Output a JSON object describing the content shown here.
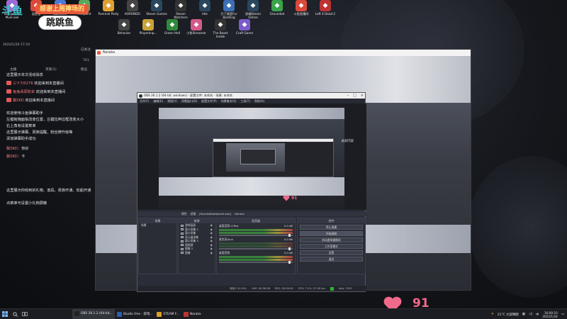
{
  "stream": {
    "logo_text": "斗鱼",
    "logo_tag": "感谢上周捧场的",
    "logo_bubble": "跳跳鱼",
    "heart_count": "91",
    "heart_count_obs": "91",
    "colors": {
      "heart": "#f06a8c",
      "accent": "#e8593c",
      "fish": "#3fc1c9"
    }
  },
  "desktop_icons": [
    {
      "icon": "bongo-cat-icon",
      "label": "Bongo Cat Mver.exe",
      "color": "#9b6bd6"
    },
    {
      "icon": "app-icon",
      "label": "逗鱼宝",
      "color": "#d84a3a"
    },
    {
      "icon": "launcher-icon",
      "label": "Launcher",
      "color": "#4a7bd8"
    },
    {
      "icon": "freeponit-icon",
      "label": "Freeponit",
      "color": "#5aa85a"
    },
    {
      "icon": "pummel-party-icon",
      "label": "Pummel Party",
      "color": "#e0a030"
    },
    {
      "icon": "korondo-icon",
      "label": "KORONDO",
      "color": "#444"
    },
    {
      "icon": "steam-icon",
      "label": "Steam Games",
      "color": "#2a475e"
    },
    {
      "icon": "steam-watcher-icon",
      "label": "Steam Watchers",
      "color": "#333"
    },
    {
      "icon": "idle-icon",
      "label": "Idle",
      "color": "#2a475e"
    },
    {
      "icon": "shortcut-icon",
      "label": "开了就是Fur Bantling",
      "color": "#3d6fb5"
    },
    {
      "icon": "steam-online-icon",
      "label": "双端Steam Online",
      "color": "#2a475e"
    },
    {
      "icon": "grounded-icon",
      "label": "Grounded",
      "color": "#3aa34a"
    },
    {
      "icon": "fish-icon",
      "label": "斗鱼直播间",
      "color": "#d84a3a"
    },
    {
      "icon": "left4dead-icon",
      "label": "Left 4 Dead 2",
      "color": "#b33"
    }
  ],
  "desktop_icons_row2": [
    {
      "icon": "behavior-icon",
      "label": "Behavior",
      "color": "#444"
    },
    {
      "icon": "playerunknown-icon",
      "label": "Playerknp...",
      "color": "#c9a23a"
    },
    {
      "icon": "green-hell-icon",
      "label": "Green Hell",
      "color": "#2e8a3a"
    },
    {
      "icon": "streamer-icon",
      "label": "小鱼Streamer",
      "color": "#d35a8a"
    },
    {
      "icon": "beast-inside-icon",
      "label": "The Beast Inside",
      "color": "#333"
    },
    {
      "icon": "craft-game-icon",
      "label": "Craft Game",
      "color": "#7a5cc9"
    }
  ],
  "chat": {
    "header_line1": "2022/1/20 17:10",
    "header_line2": "已关注",
    "header_count": "741",
    "col_tabs": [
      "主播",
      "贵族(1)",
      "粉丝"
    ],
    "notice": "这里展示本次活动消息",
    "messages": [
      {
        "user": "三十7/0276",
        "text": "欢迎来到本直播间"
      },
      {
        "user": "兔兔毒尿粉本",
        "text": "欢迎来到本直播间"
      },
      {
        "user": "飘5KD",
        "text": "欢迎来到本直播间"
      }
    ],
    "help_lines": [
      "欢迎使用斗鱼弹幕助手",
      "左键拖拽面板改变位置，左键拉伸边框改变大小",
      "右上角有设置菜单",
      "这里展示弹幕、贵族提醒、粉丝牌升级等",
      "添加弹幕助手成功"
    ],
    "user_lines": [
      {
        "user": "飘5KD：",
        "text": "你好"
      },
      {
        "user": "飘5KD：",
        "text": "卡"
      }
    ],
    "footer_lines": [
      "这里展示你收到的礼物、道具、贵族开通、轮船开通",
      "点菜单可设置小礼物屏蔽"
    ]
  },
  "outer_window": {
    "title": "Naraka"
  },
  "obs": {
    "title": "OBS 26.1.2 (64-bit, windows) - 配置文件: 未命名 - 场景: 未命名",
    "menus": [
      "文件(F)",
      "编辑(E)",
      "视图(V)",
      "停靠窗口(D)",
      "配置文件(P)",
      "场景集合(S)",
      "工具(T)",
      "帮助(H)"
    ],
    "preview_label": "录屏内容",
    "controls_bar": [
      "属性",
      "滤镜",
      "[NarakaBladepoint.exe]",
      "Naraka"
    ],
    "scenes_header": "场景",
    "scenes": [
      "场景"
    ],
    "sources_header": "来源",
    "sources": [
      "游戏画面",
      "窗口采集 2",
      "窗口采集",
      "显示器采集",
      "窗口采集 3",
      "视频源",
      "图像 2",
      "图像"
    ],
    "mixer_header": "混音器",
    "mixer": [
      {
        "name": "桌面音频 2/Test",
        "db": "0.0 dB"
      },
      {
        "name": "麦克风/Aux",
        "db": "0.0 dB"
      },
      {
        "name": "桌面音频",
        "db": "0.0 dB"
      }
    ],
    "controls_header": "控件",
    "controls": [
      {
        "label": "停止直播",
        "active": false
      },
      {
        "label": "开始录制",
        "active": true
      },
      {
        "label": "启动虚拟摄像机",
        "active": false
      },
      {
        "label": "工作室模式",
        "active": false
      },
      {
        "label": "设置",
        "active": false
      },
      {
        "label": "退出",
        "active": false
      }
    ],
    "status": [
      "丢帧 0 (0.0%)",
      "LIVE: 00:58:36",
      "REC: 00:00:00",
      "CPU: 7.2%, 57.00 fps",
      "kb/s: 7020"
    ]
  },
  "taskbar": {
    "items": [
      {
        "label": "OBS 26.1.2 (64-bit...",
        "color": "#222",
        "active": true
      },
      {
        "label": "Studio One - 游戏...",
        "color": "#2b5fa8",
        "active": false
      },
      {
        "label": "STEAM F...",
        "color": "#d8a22a",
        "active": false
      },
      {
        "label": "Naraka",
        "color": "#b33",
        "active": false
      }
    ],
    "weather": "21°C 大部晴朗",
    "time": "16:00:10",
    "date": "2022/1/24"
  }
}
